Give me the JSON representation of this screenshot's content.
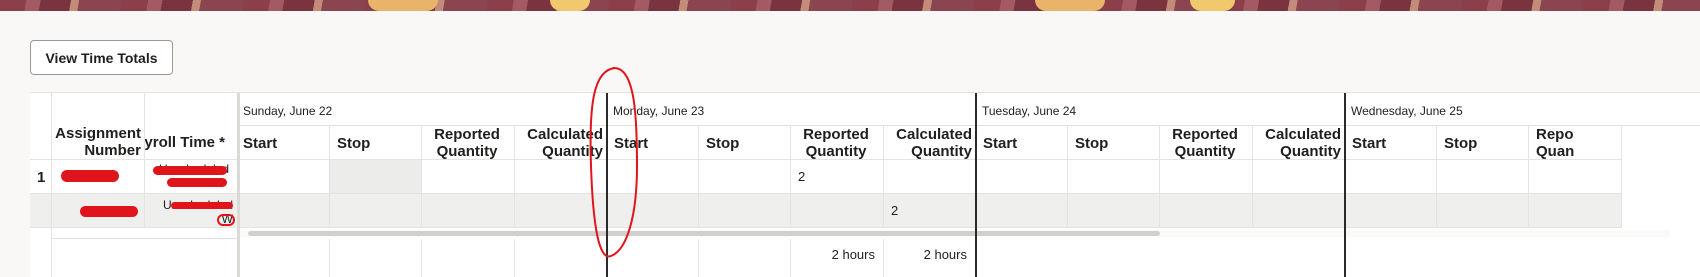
{
  "banner": {
    "accent_color": "#8a3f4a",
    "highlight_color": "#f0c86e"
  },
  "toolbar": {
    "view_time_totals_label": "View Time Totals"
  },
  "table": {
    "row_header_col": "",
    "col_assignment_number": "Assignment Number",
    "col_payroll_time_type": "Payroll Time *",
    "days": [
      {
        "label": "Sunday, June 22",
        "start": "Start",
        "stop": "Stop",
        "reported": "Reported Quantity",
        "calculated": "Calculated Quantity"
      },
      {
        "label": "Monday, June 23",
        "start": "Start",
        "stop": "Stop",
        "reported": "Reported Quantity",
        "calculated": "Calculated Quantity"
      },
      {
        "label": "Tuesday, June 24",
        "start": "Start",
        "stop": "Stop",
        "reported": "Reported Quantity",
        "calculated": "Calculated Quantity"
      },
      {
        "label": "Wednesday, June 25",
        "start": "Start",
        "stop": "Stop",
        "reported": "Repo Quan"
      }
    ],
    "rows": [
      {
        "row_number": "1",
        "assignment_number": "[redacted]",
        "time_type": "Unscheduled",
        "monday_reported": "2",
        "monday_calculated": ""
      },
      {
        "row_number": "",
        "assignment_number": "[redacted]",
        "time_type": "Unscheduled W",
        "monday_reported": "",
        "monday_calculated": "2"
      }
    ],
    "totals": {
      "monday_reported": "2 hours",
      "monday_calculated": "2 hours"
    }
  },
  "annotation_color": "#e0151b"
}
